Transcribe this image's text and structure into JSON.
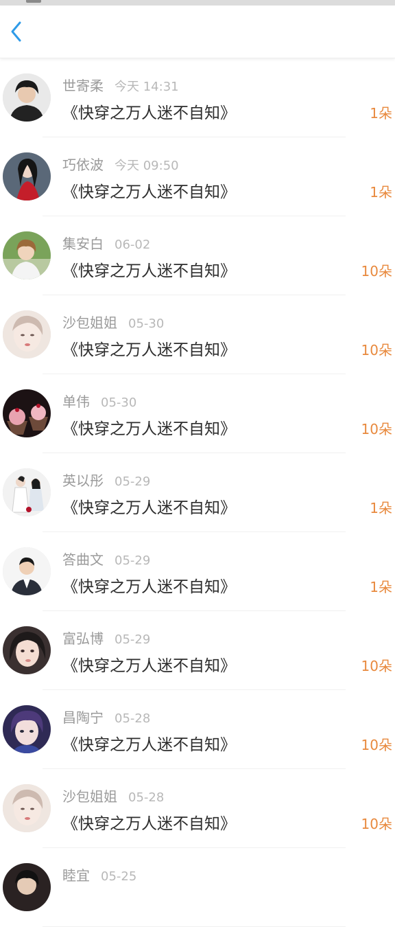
{
  "nav": {
    "back_icon": "chevron-left-icon",
    "accent": "#2f9be8"
  },
  "colors": {
    "count": "#e8893d",
    "name": "#9a9a9a",
    "title": "#2d2d2d"
  },
  "rows": [
    {
      "name": "世寄柔",
      "time": "今天 14:31",
      "title": "《快穿之万人迷不自知》",
      "count": "1朵",
      "avatar": "person-dark-hair"
    },
    {
      "name": "巧依波",
      "time": "今天 09:50",
      "title": "《快穿之万人迷不自知》",
      "count": "1朵",
      "avatar": "woman-red-dress"
    },
    {
      "name": "集安白",
      "time": "06-02",
      "title": "《快穿之万人迷不自知》",
      "count": "10朵",
      "avatar": "man-outdoor"
    },
    {
      "name": "沙包姐姐",
      "time": "05-30",
      "title": "《快穿之万人迷不自知》",
      "count": "10朵",
      "avatar": "illustrated-girl"
    },
    {
      "name": "单伟",
      "time": "05-30",
      "title": "《快穿之万人迷不自知》",
      "count": "10朵",
      "avatar": "cupcakes"
    },
    {
      "name": "英以彤",
      "time": "05-29",
      "title": "《快穿之万人迷不自知》",
      "count": "1朵",
      "avatar": "costume-figures"
    },
    {
      "name": "答曲文",
      "time": "05-29",
      "title": "《快穿之万人迷不自知》",
      "count": "1朵",
      "avatar": "man-suit"
    },
    {
      "name": "富弘博",
      "time": "05-29",
      "title": "《快穿之万人迷不自知》",
      "count": "10朵",
      "avatar": "girl-dark-hair"
    },
    {
      "name": "昌陶宁",
      "time": "05-28",
      "title": "《快穿之万人迷不自知》",
      "count": "10朵",
      "avatar": "boy-purple"
    },
    {
      "name": "沙包姐姐",
      "time": "05-28",
      "title": "《快穿之万人迷不自知》",
      "count": "10朵",
      "avatar": "illustrated-girl"
    },
    {
      "name": "睦宜",
      "time": "05-25",
      "title": "",
      "count": "",
      "avatar": "person-dark"
    }
  ]
}
